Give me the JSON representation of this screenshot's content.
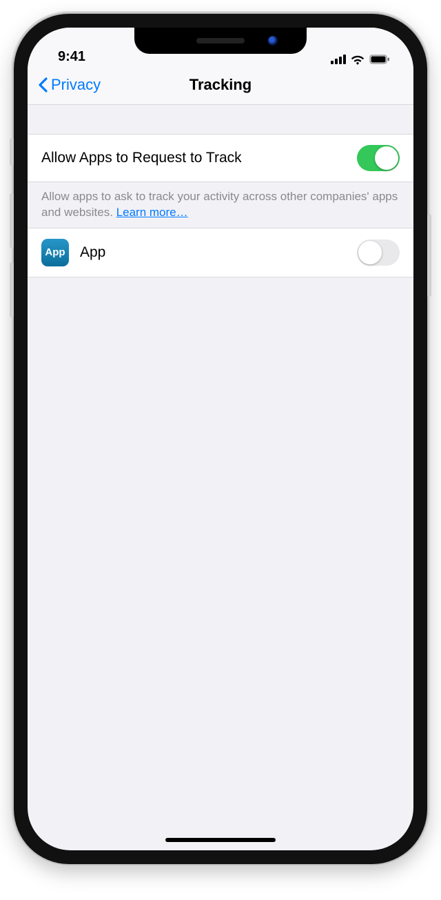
{
  "status": {
    "time": "9:41"
  },
  "nav": {
    "back_label": "Privacy",
    "title": "Tracking"
  },
  "main_row": {
    "label": "Allow Apps to Request to Track",
    "enabled": true
  },
  "footer": {
    "text": "Allow apps to ask to track your activity across other companies' apps and websites. ",
    "link": "Learn more…"
  },
  "apps": [
    {
      "name": "App",
      "icon_label": "App",
      "enabled": false
    }
  ]
}
